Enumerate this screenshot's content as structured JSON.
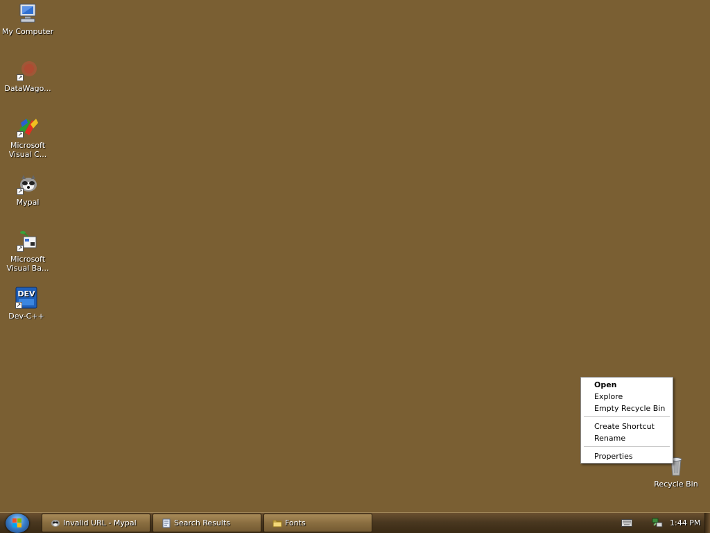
{
  "desktop": {
    "background_color": "#7a5f33",
    "icons": [
      {
        "label": "My Computer",
        "icon": "my-computer-icon"
      },
      {
        "label": "DataWago...",
        "icon": "datawagon-icon"
      },
      {
        "label": "Microsoft\nVisual C...",
        "icon": "visual-cpp-icon"
      },
      {
        "label": "Mypal",
        "icon": "mypal-icon"
      },
      {
        "label": "Microsoft\nVisual Ba...",
        "icon": "visual-basic-icon"
      },
      {
        "label": "Dev-C++",
        "icon": "dev-cpp-icon"
      }
    ],
    "recycle_bin": {
      "label": "Recycle Bin",
      "icon": "recycle-bin-icon"
    }
  },
  "context_menu": {
    "items": [
      {
        "label": "Open",
        "bold": true
      },
      {
        "label": "Explore"
      },
      {
        "label": "Empty Recycle Bin"
      },
      {
        "label": "Create Shortcut"
      },
      {
        "label": "Rename"
      },
      {
        "label": "Properties"
      }
    ]
  },
  "taskbar": {
    "start_icon": "windows-start-icon",
    "buttons": [
      {
        "label": "Invalid URL - Mypal",
        "icon": "mypal-icon"
      },
      {
        "label": "Search Results",
        "icon": "search-results-icon"
      },
      {
        "label": "Fonts",
        "icon": "folder-icon"
      }
    ],
    "tray": {
      "icons": [
        "keyboard-icon",
        "network-icon"
      ],
      "clock": "1:44 PM"
    }
  }
}
